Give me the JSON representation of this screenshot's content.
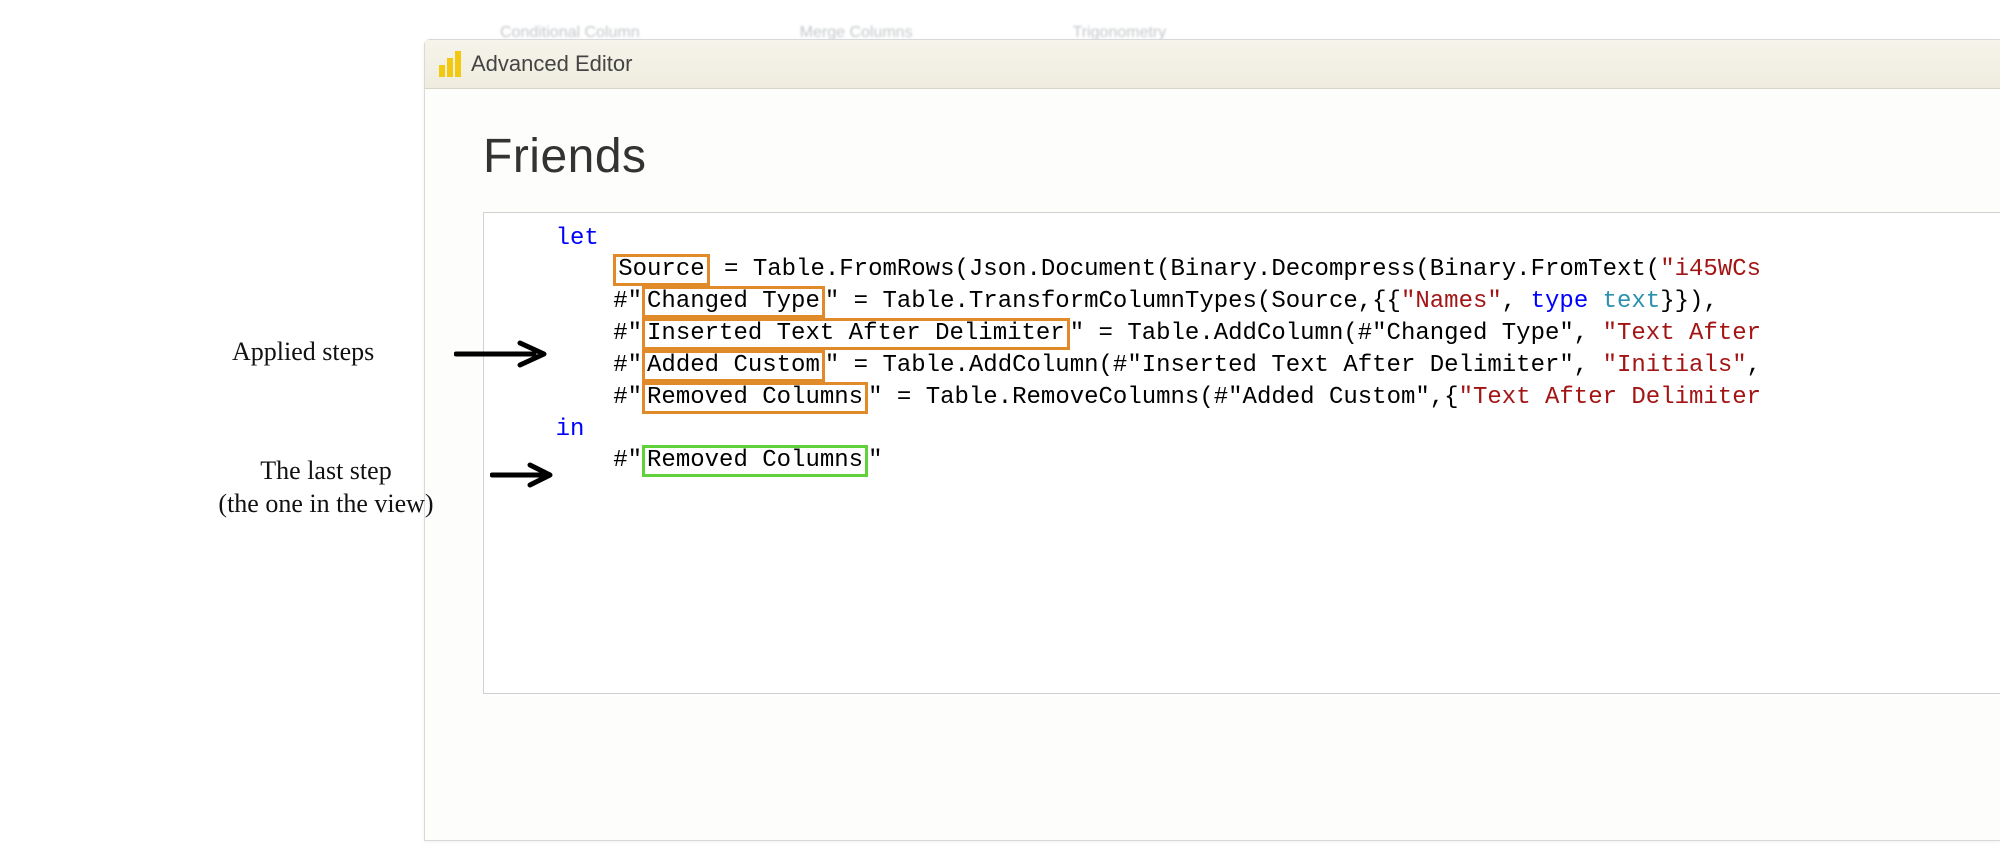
{
  "titlebar": {
    "title": "Advanced Editor"
  },
  "query_name": "Friends",
  "code": {
    "kw_let": "let",
    "kw_in": "in",
    "kw_type": "type",
    "type_text": "text",
    "indent_line": "    ",
    "indent_step": "        ",
    "step_prefix": "#\"",
    "step_suffix": "\"",
    "steps": {
      "source": {
        "name": "Source",
        "rhs_a": " = Table.FromRows(Json.Document(Binary.Decompress(Binary.FromText(",
        "rhs_b": "\"i45WCs"
      },
      "changed": {
        "name": "Changed Type",
        "rhs_a": " = Table.TransformColumnTypes(Source,{{",
        "rhs_b": "\"Names\"",
        "rhs_c": ", ",
        "rhs_d": "}}),",
        "prefix": "#\"",
        "suffix": "\""
      },
      "inserted": {
        "name": "Inserted Text After Delimiter",
        "rhs_a": " = Table.AddColumn(#\"Changed Type\", ",
        "rhs_b": "\"Text After"
      },
      "added": {
        "name": "Added Custom",
        "rhs_a": " = Table.AddColumn(#\"Inserted Text After Delimiter\", ",
        "rhs_b": "\"Initials\"",
        "rhs_c": ","
      },
      "removed": {
        "name": "Removed Columns",
        "rhs_a": " = Table.RemoveColumns(#\"Added Custom\",{",
        "rhs_b": "\"Text After Delimiter"
      },
      "result": {
        "name": "Removed Columns"
      }
    }
  },
  "annotations": {
    "applied_steps": "Applied steps",
    "last_step_line1": "The last step",
    "last_step_line2": "(the one in the view)"
  },
  "ghost_ribbon": [
    "Conditional Column",
    "Merge Columns",
    "Trigonometry"
  ]
}
